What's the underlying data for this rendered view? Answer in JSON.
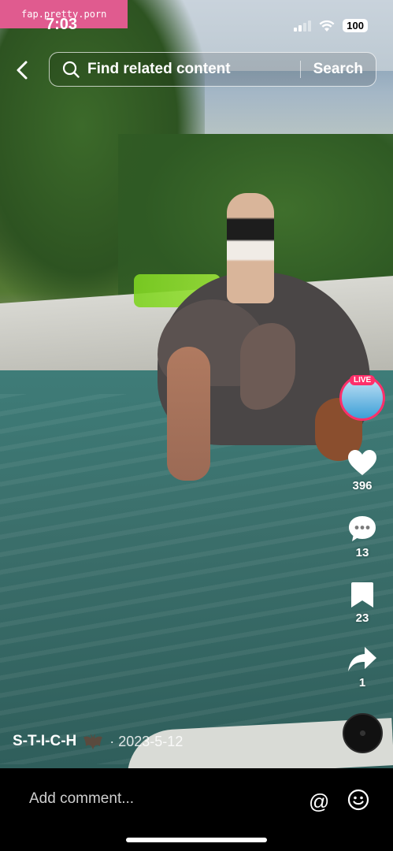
{
  "watermark": "fap.pretty.porn",
  "status": {
    "time": "7:03",
    "battery": "100"
  },
  "search": {
    "placeholder": "Find related content",
    "button": "Search"
  },
  "live": {
    "label": "LIVE"
  },
  "actions": {
    "likes": "396",
    "comments": "13",
    "saves": "23",
    "shares": "1"
  },
  "caption": {
    "username": "S-T-I-C-H",
    "date": "· 2023-5-12"
  },
  "comment_bar": {
    "placeholder": "Add comment...",
    "at": "@"
  }
}
